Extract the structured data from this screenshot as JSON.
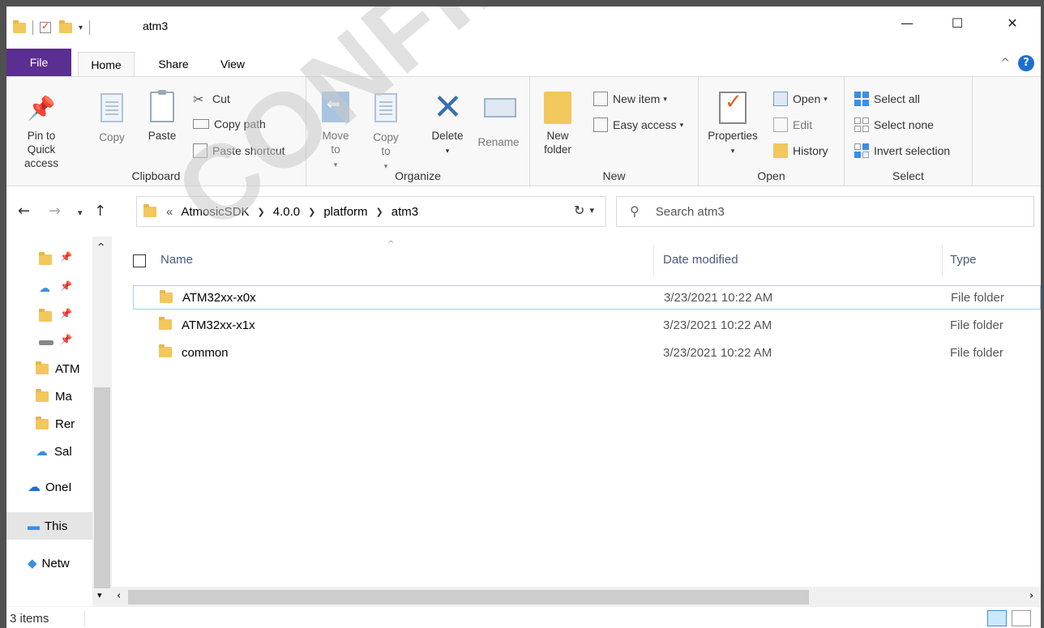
{
  "window": {
    "title": "atm3",
    "controls": {
      "minimize": "—",
      "maximize": "☐",
      "close": "✕"
    }
  },
  "tabs": [
    {
      "label": "File"
    },
    {
      "label": "Home"
    },
    {
      "label": "Share"
    },
    {
      "label": "View"
    }
  ],
  "help": {
    "collapse": "^",
    "help": "?"
  },
  "ribbon": {
    "clipboard": {
      "label": "Clipboard",
      "pin": "Pin to Quick access",
      "copy": "Copy",
      "paste": "Paste",
      "cut": "Cut",
      "copy_path": "Copy path",
      "paste_shortcut": "Paste shortcut"
    },
    "organize": {
      "label": "Organize",
      "move_to": "Move to",
      "copy_to": "Copy to",
      "delete": "Delete",
      "rename": "Rename"
    },
    "new": {
      "label": "New",
      "new_folder": "New folder",
      "new_item": "New item",
      "easy_access": "Easy access"
    },
    "open": {
      "label": "Open",
      "properties": "Properties",
      "open": "Open",
      "edit": "Edit",
      "history": "History"
    },
    "select": {
      "label": "Select",
      "select_all": "Select all",
      "select_none": "Select none",
      "invert_selection": "Invert selection"
    }
  },
  "address": {
    "overflow": "«",
    "crumbs": [
      "AtmosicSDK",
      "4.0.0",
      "platform",
      "atm3"
    ]
  },
  "search": {
    "placeholder": "Search atm3"
  },
  "navpane": {
    "items": [
      "ATM",
      "Ma",
      "Rer",
      "Sal",
      "OneI",
      "This",
      "Netw"
    ]
  },
  "columns": {
    "name": "Name",
    "date": "Date modified",
    "type": "Type"
  },
  "files": [
    {
      "name": "ATM32xx-x0x",
      "date": "3/23/2021 10:22 AM",
      "type": "File folder"
    },
    {
      "name": "ATM32xx-x1x",
      "date": "3/23/2021 10:22 AM",
      "type": "File folder"
    },
    {
      "name": "common",
      "date": "3/23/2021 10:22 AM",
      "type": "File folder"
    }
  ],
  "status": {
    "items": "3 items"
  },
  "watermark": "CONFIDENTIAL",
  "colors": {
    "file_tab": "#5b2e91",
    "folder": "#f2c75c",
    "selection": "#99d1ff",
    "accent": "#1c6fd1"
  }
}
